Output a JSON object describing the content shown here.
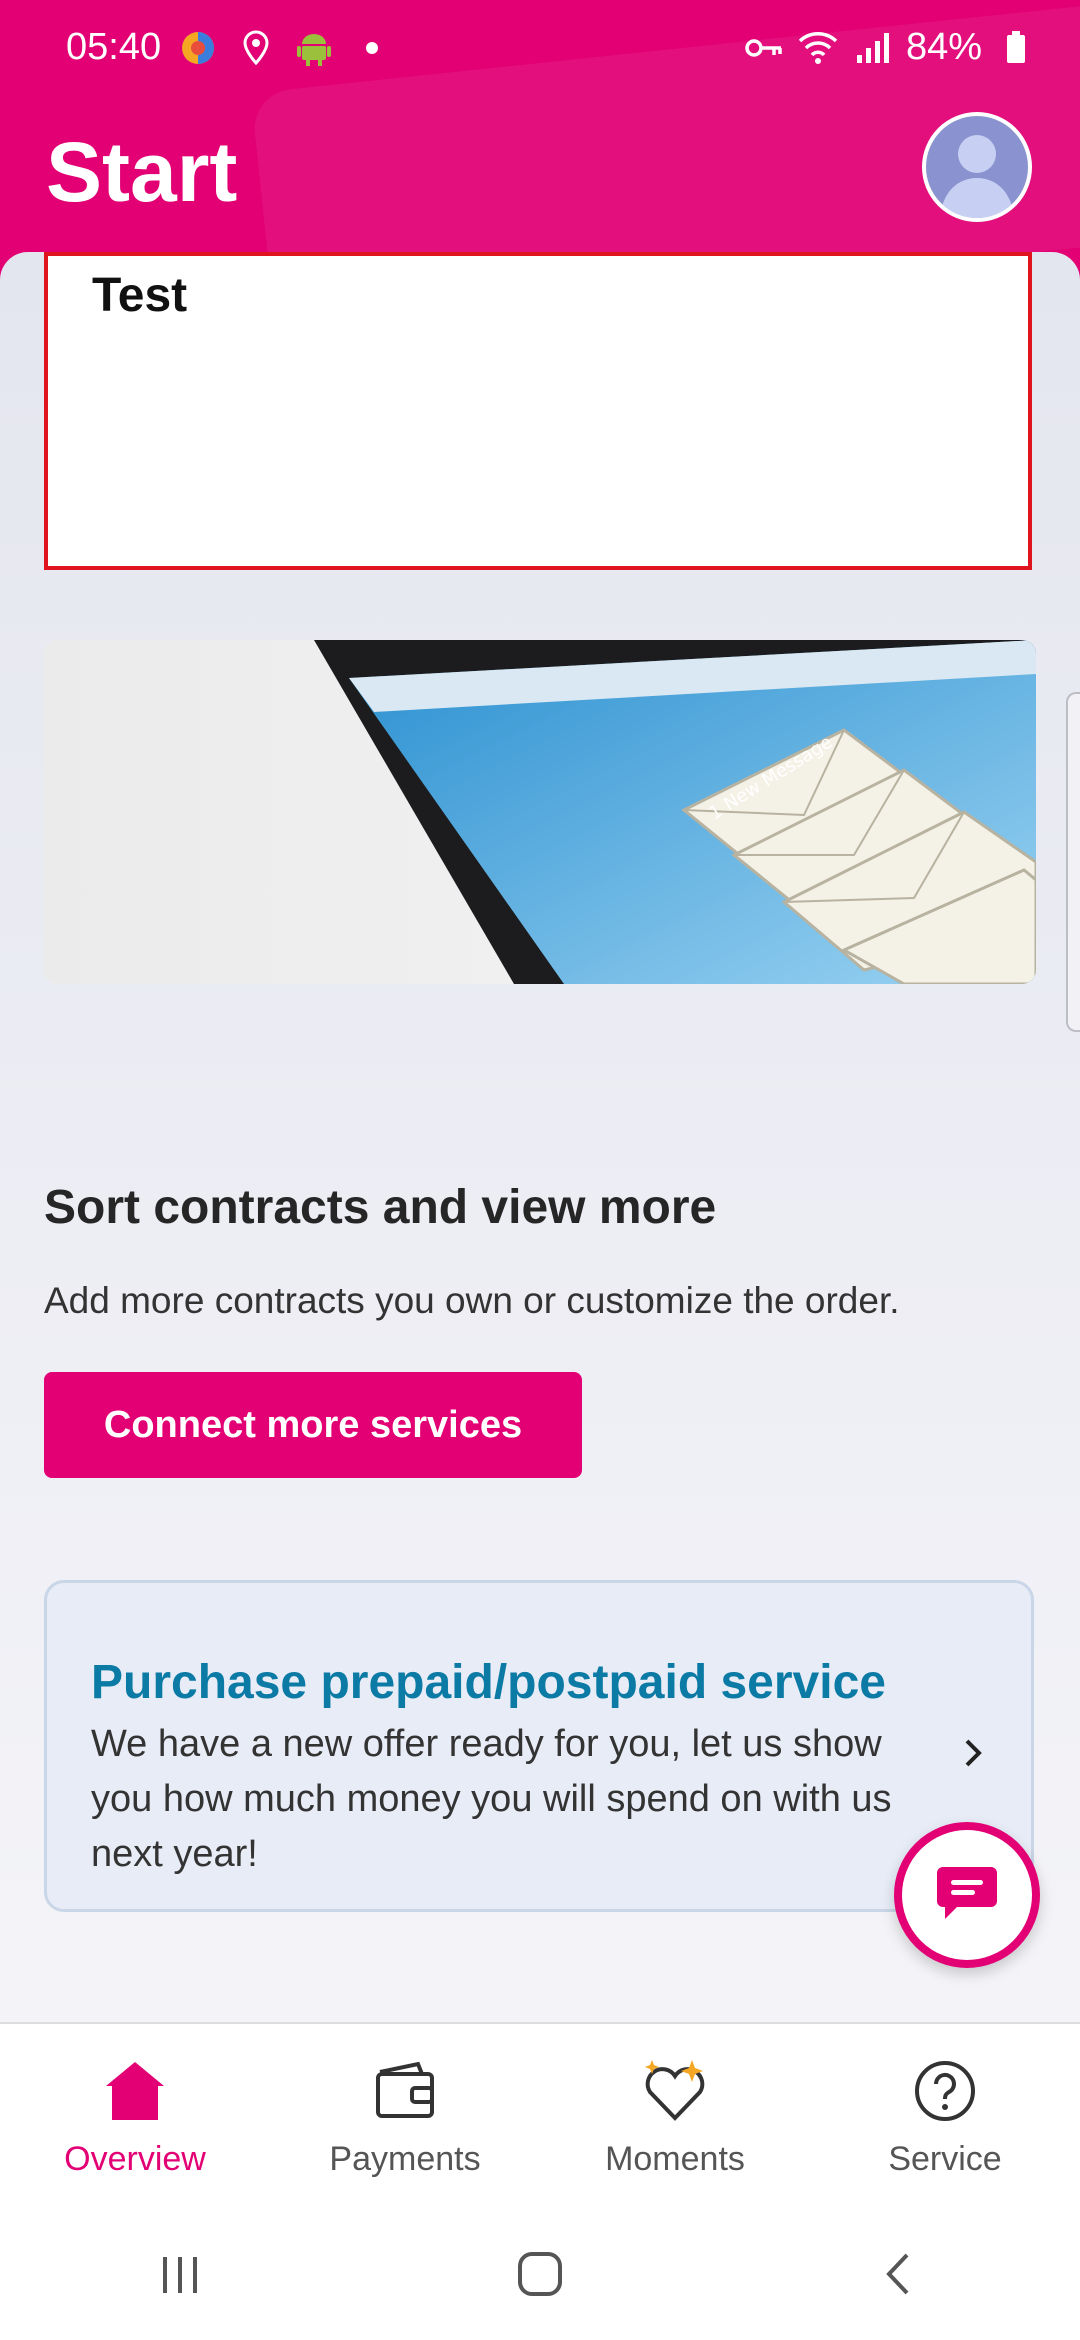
{
  "status_bar": {
    "time": "05:40",
    "battery": "84%",
    "icons_left": [
      "browser-icon",
      "location-icon",
      "android-icon",
      "dot-icon"
    ],
    "icons_right": [
      "vpn-key-icon",
      "wifi-icon",
      "signal-icon",
      "battery-icon"
    ]
  },
  "header": {
    "title": "Start",
    "avatar_icon": "avatar-icon"
  },
  "test_card": {
    "title": "Test"
  },
  "sort_section": {
    "title": "Sort contracts and view more",
    "description": "Add more contracts you own or customize the order.",
    "button_label": "Connect more services"
  },
  "offer_card": {
    "title": "Purchase prepaid/postpaid service",
    "text": "We have a new offer ready for you, let us show you how much money you will spend on with us next year!"
  },
  "bottom_nav": {
    "items": [
      {
        "label": "Overview",
        "icon": "home-icon",
        "active": true
      },
      {
        "label": "Payments",
        "icon": "wallet-icon",
        "active": false
      },
      {
        "label": "Moments",
        "icon": "heart-sparkle-icon",
        "active": false
      },
      {
        "label": "Service",
        "icon": "help-icon",
        "active": false
      }
    ]
  },
  "colors": {
    "brand": "#e20074",
    "offer_title": "#0b7aa5",
    "test_border": "#e0141e"
  }
}
